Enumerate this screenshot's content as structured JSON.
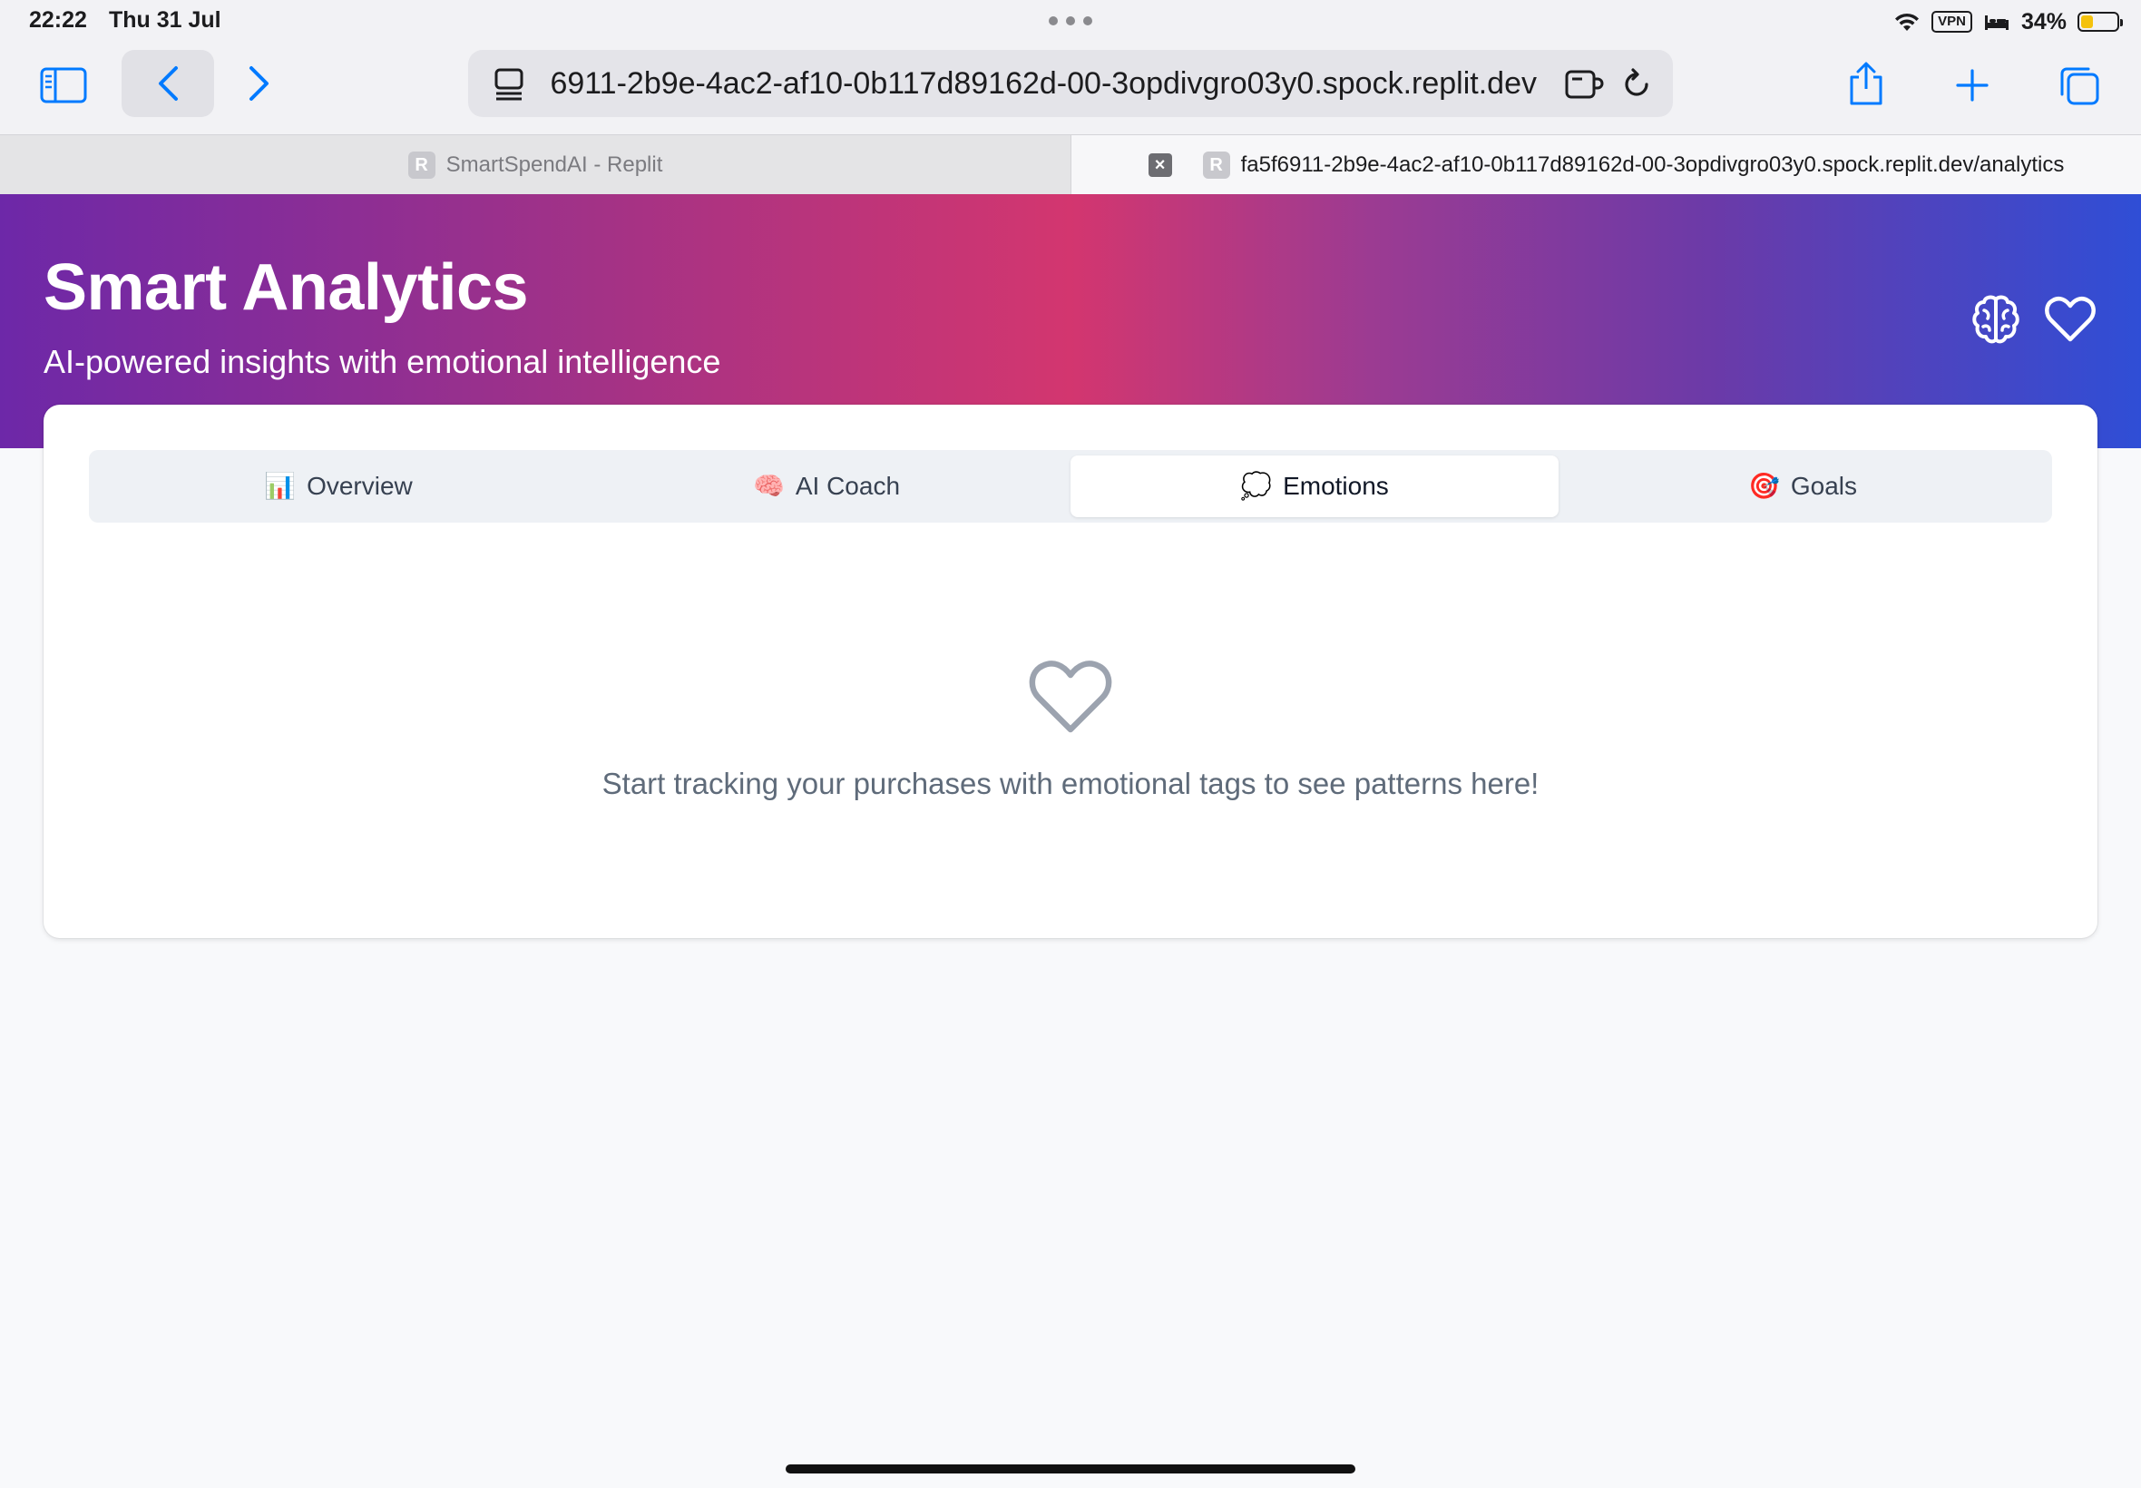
{
  "status_bar": {
    "time": "22:22",
    "date": "Thu 31 Jul",
    "vpn": "VPN",
    "battery": "34%",
    "battery_level": 0.34
  },
  "browser": {
    "address": "fa5f6911-2b9e-4ac2-af10-0b117d89162d-00-3opdivgro03y0.spock.replit.dev",
    "tabs": [
      {
        "label": "SmartSpendAI - Replit",
        "favicon": "R",
        "active": false
      },
      {
        "label": "fa5f6911-2b9e-4ac2-af10-0b117d89162d-00-3opdivgro03y0.spock.replit.dev/analytics",
        "favicon": "R",
        "active": true
      }
    ]
  },
  "hero": {
    "title": "Smart Analytics",
    "subtitle": "AI-powered insights with emotional intelligence",
    "icons": [
      "brain-icon",
      "heart-icon"
    ]
  },
  "analytics_tabs": [
    {
      "emoji": "📊",
      "label": "Overview",
      "active": false
    },
    {
      "emoji": "🧠",
      "label": "AI Coach",
      "active": false
    },
    {
      "emoji": "💭",
      "label": "Emotions",
      "active": true
    },
    {
      "emoji": "🎯",
      "label": "Goals",
      "active": false
    }
  ],
  "empty_state": {
    "icon": "heart-outline-icon",
    "message": "Start tracking your purchases with emotional tags to see patterns here!"
  },
  "colors": {
    "accent_blue": "#007aff",
    "gradient_start": "#6d28a8",
    "gradient_mid": "#d3366f",
    "gradient_end": "#2f4ed6"
  }
}
